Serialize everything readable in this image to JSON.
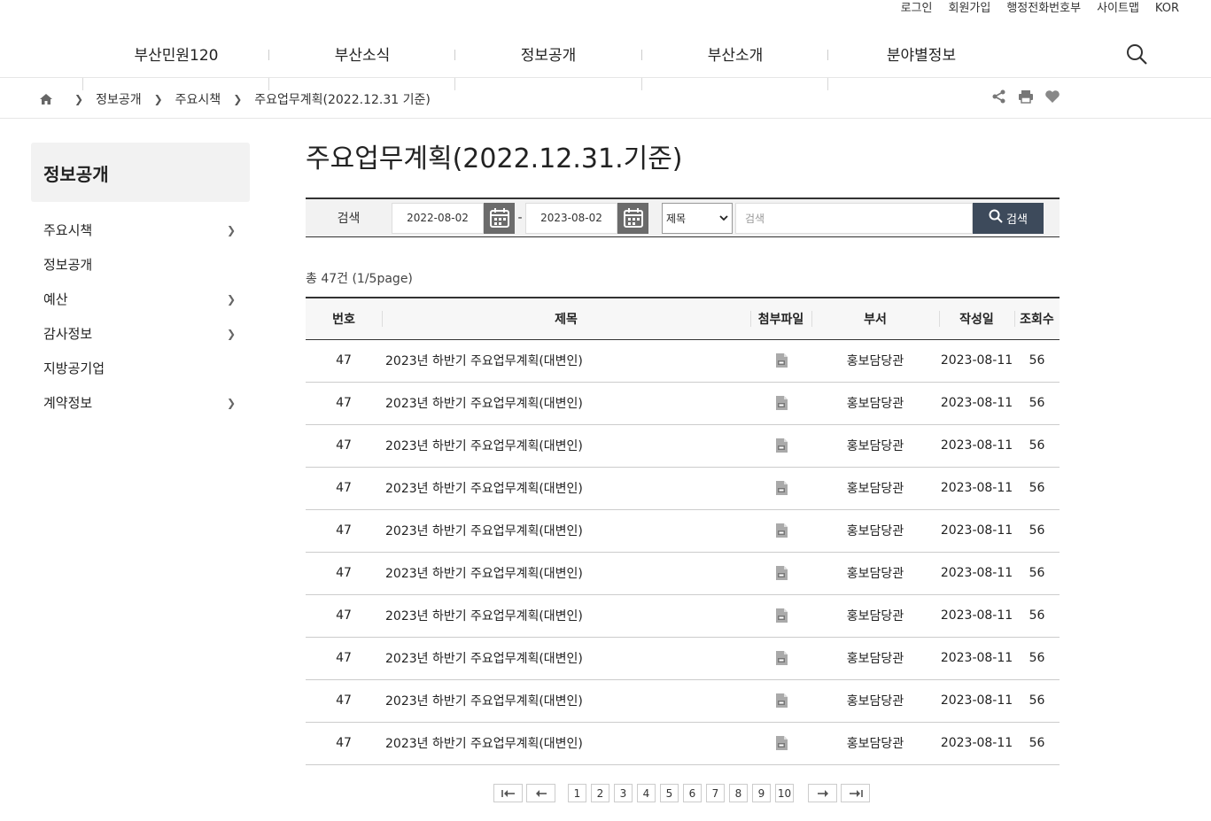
{
  "util_links": [
    "로그인",
    "회원가입",
    "행정전화번호부",
    "사이트맵",
    "KOR"
  ],
  "gnb": [
    "부산민원120",
    "부산소식",
    "정보공개",
    "부산소개",
    "분야별정보"
  ],
  "breadcrumb": [
    "정보공개",
    "주요시책",
    "주요업무계획(2022.12.31 기준)"
  ],
  "lnb": {
    "title": "정보공개",
    "items": [
      {
        "label": "주요시책",
        "has_sub": true
      },
      {
        "label": "정보공개",
        "has_sub": false
      },
      {
        "label": "예산",
        "has_sub": true
      },
      {
        "label": "감사정보",
        "has_sub": true
      },
      {
        "label": "지방공기업",
        "has_sub": false
      },
      {
        "label": "계약정보",
        "has_sub": true
      }
    ]
  },
  "page_title": "주요업무계획(2022.12.31.기준)",
  "search": {
    "label": "검색",
    "date_from": "2022-08-02",
    "date_to": "2023-08-02",
    "field_selected": "제목",
    "placeholder": "검색",
    "button": "검색"
  },
  "total_text": "총 47건 (1/5page)",
  "table": {
    "headers": [
      "번호",
      "제목",
      "첨부파일",
      "부서",
      "작성일",
      "조회수"
    ],
    "rows": [
      {
        "no": "47",
        "title": "2023년 하반기 주요업무계획(대변인)",
        "dept": "홍보담당관",
        "date": "2023-08-11",
        "views": "56"
      },
      {
        "no": "47",
        "title": "2023년 하반기 주요업무계획(대변인)",
        "dept": "홍보담당관",
        "date": "2023-08-11",
        "views": "56"
      },
      {
        "no": "47",
        "title": "2023년 하반기 주요업무계획(대변인)",
        "dept": "홍보담당관",
        "date": "2023-08-11",
        "views": "56"
      },
      {
        "no": "47",
        "title": "2023년 하반기 주요업무계획(대변인)",
        "dept": "홍보담당관",
        "date": "2023-08-11",
        "views": "56"
      },
      {
        "no": "47",
        "title": "2023년 하반기 주요업무계획(대변인)",
        "dept": "홍보담당관",
        "date": "2023-08-11",
        "views": "56"
      },
      {
        "no": "47",
        "title": "2023년 하반기 주요업무계획(대변인)",
        "dept": "홍보담당관",
        "date": "2023-08-11",
        "views": "56"
      },
      {
        "no": "47",
        "title": "2023년 하반기 주요업무계획(대변인)",
        "dept": "홍보담당관",
        "date": "2023-08-11",
        "views": "56"
      },
      {
        "no": "47",
        "title": "2023년 하반기 주요업무계획(대변인)",
        "dept": "홍보담당관",
        "date": "2023-08-11",
        "views": "56"
      },
      {
        "no": "47",
        "title": "2023년 하반기 주요업무계획(대변인)",
        "dept": "홍보담당관",
        "date": "2023-08-11",
        "views": "56"
      },
      {
        "no": "47",
        "title": "2023년 하반기 주요업무계획(대변인)",
        "dept": "홍보담당관",
        "date": "2023-08-11",
        "views": "56"
      }
    ]
  },
  "pagination": {
    "pages": [
      "1",
      "2",
      "3",
      "4",
      "5",
      "6",
      "7",
      "8",
      "9",
      "10"
    ],
    "first": "first-page-icon",
    "prev": "prev-page-icon",
    "next": "next-page-icon",
    "last": "last-page-icon"
  },
  "icons": {
    "home": "home-icon",
    "share": "share-icon",
    "print": "print-icon",
    "favorite": "heart-icon",
    "search": "search-icon",
    "calendar": "calendar-icon",
    "attachment": "file-icon"
  }
}
